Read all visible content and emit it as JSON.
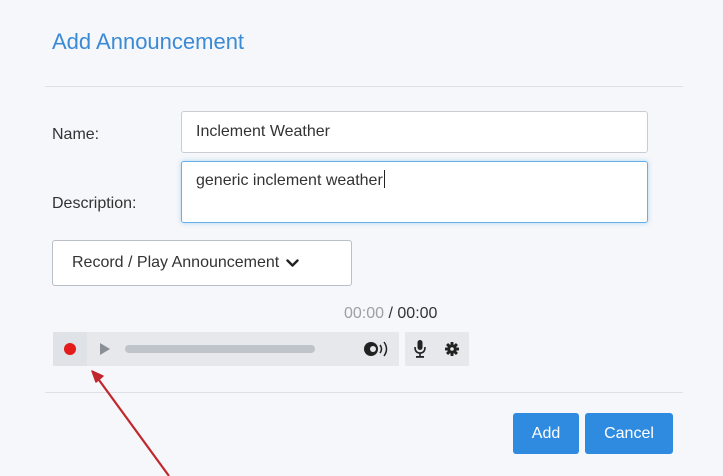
{
  "dialog": {
    "title": "Add Announcement",
    "name_label": "Name:",
    "name_value": "Inclement Weather",
    "description_label": "Description:",
    "description_value": "generic inclement weather",
    "record_play_label": "Record / Play Announcement"
  },
  "player": {
    "current_time": "00:00",
    "separator": " / ",
    "duration": "00:00",
    "progress": 0,
    "icons": [
      "record-icon",
      "play-icon",
      "volume-icon",
      "microphone-icon",
      "gear-icon"
    ]
  },
  "actions": {
    "add_label": "Add",
    "cancel_label": "Cancel"
  },
  "colors": {
    "accent": "#2f8be0",
    "title": "#3b8ad6",
    "record": "#e31b1b",
    "annotation_arrow": "#c0282d"
  }
}
